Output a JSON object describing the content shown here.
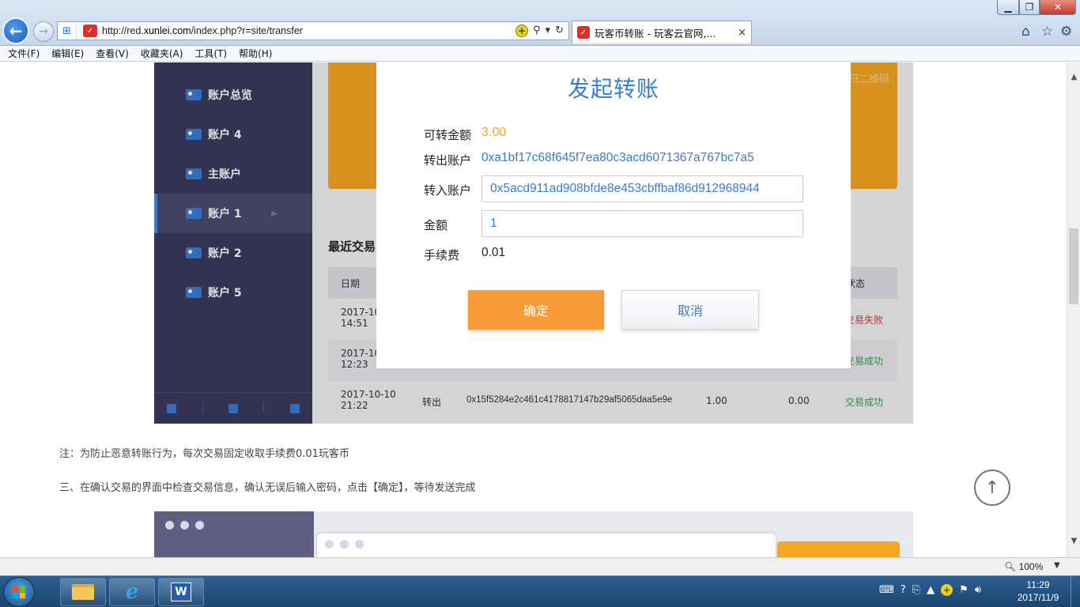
{
  "browser": {
    "url_prefix": "http://red.",
    "url_domain": "xunlei.com",
    "url_path": "/index.php?r=site/transfer",
    "tab_title": "玩客币转账 - 玩客云官网,...",
    "tab_close": "×",
    "site_icon_glyph": "✓"
  },
  "window_controls": {
    "minimize": "▁",
    "maximize": "❐",
    "close": "✕"
  },
  "menu": [
    "文件(F)",
    "编辑(E)",
    "查看(V)",
    "收藏夹(A)",
    "工具(T)",
    "帮助(H)"
  ],
  "sidebar": {
    "items": [
      {
        "label": "账户总览",
        "active": false
      },
      {
        "label": "账户 4",
        "active": false
      },
      {
        "label": "主账户",
        "active": false
      },
      {
        "label": "账户 1",
        "active": true
      },
      {
        "label": "账户 2",
        "active": false
      },
      {
        "label": "账户 5",
        "active": false
      }
    ]
  },
  "background_page": {
    "qr_hint": "扫二维码",
    "recent_title": "最近交易",
    "table_headers": {
      "date": "日期",
      "status": "状态"
    },
    "rows": [
      {
        "date": "2017-10",
        "time": "14:51",
        "direction": "",
        "hash": "",
        "amount": "",
        "fee": "",
        "status": "交易失败",
        "status_type": "fail"
      },
      {
        "date": "2017-10",
        "time": "12:23",
        "direction": "",
        "hash": "",
        "amount": "",
        "fee": "",
        "status": "交易成功",
        "status_type": "ok"
      },
      {
        "date": "2017-10-10",
        "time": "21:22",
        "direction": "转出",
        "hash": "0x15f5284e2c461c4178817147b29af5065daa5e9e",
        "amount": "1.00",
        "fee": "0.00",
        "status": "交易成功",
        "status_type": "ok"
      }
    ],
    "note": "注：为防止恶意转账行为，每次交易固定收取手续费0.01玩客币",
    "step3": "三、在确认交易的界面中检查交易信息，确认无误后输入密码，点击【确定】，等待发送完成"
  },
  "dialog": {
    "title": "发起转账",
    "balance_label": "可转金额",
    "balance_value": "3.00",
    "from_label": "转出账户",
    "from_value": "0xa1bf17c68f645f7ea80c3acd6071367a767bc7a5",
    "to_label": "转入账户",
    "to_value": "0x5acd911ad908bfde8e453cbffbaf86d912968944",
    "amount_label": "金额",
    "amount_value": "1",
    "fee_label": "手续费",
    "fee_value": "0.01",
    "confirm_label": "确定",
    "cancel_label": "取消"
  },
  "statusbar": {
    "zoom": "100%"
  },
  "taskbar": {
    "time": "11:29",
    "date": "2017/11/9"
  },
  "colors": {
    "accent_blue": "#3a7bd5",
    "accent_orange": "#f99a38",
    "sidebar_bg": "#3a3a5e",
    "fail_red": "#e03a3a",
    "ok_green": "#2aa845"
  }
}
